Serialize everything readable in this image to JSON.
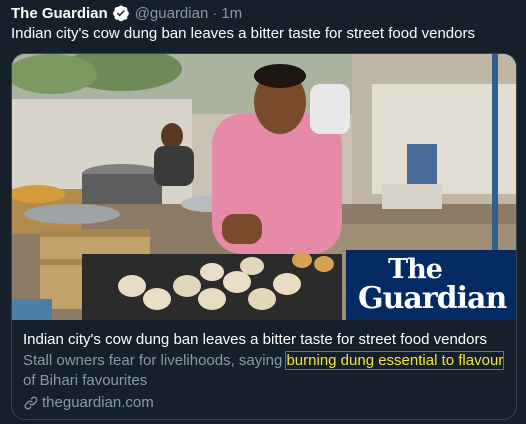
{
  "tweet": {
    "author_name": "The Guardian",
    "handle": "@guardian",
    "separator": "·",
    "time": "1m",
    "text": "Indian city's cow dung ban leaves a bitter taste for street food vendors"
  },
  "card": {
    "image_alt": "Street food vendor frying snacks",
    "brand_line1": "The",
    "brand_line2": "Guardian",
    "title": "Indian city's cow dung ban leaves a bitter taste for street food vendors",
    "desc_prefix": "Stall owners fear for livelihoods, saying ",
    "desc_highlight": "burning dung essential to flavour",
    "desc_suffix": "of Bihari favourites",
    "domain": "theguardian.com"
  },
  "icons": {
    "verified": "verified-badge-icon",
    "link": "link-icon"
  },
  "colors": {
    "background": "#15202b",
    "secondary_text": "#8899a6",
    "verified_blue": "#1da1f2",
    "guardian_blue": "#052962",
    "highlight": "#f5e43a"
  }
}
